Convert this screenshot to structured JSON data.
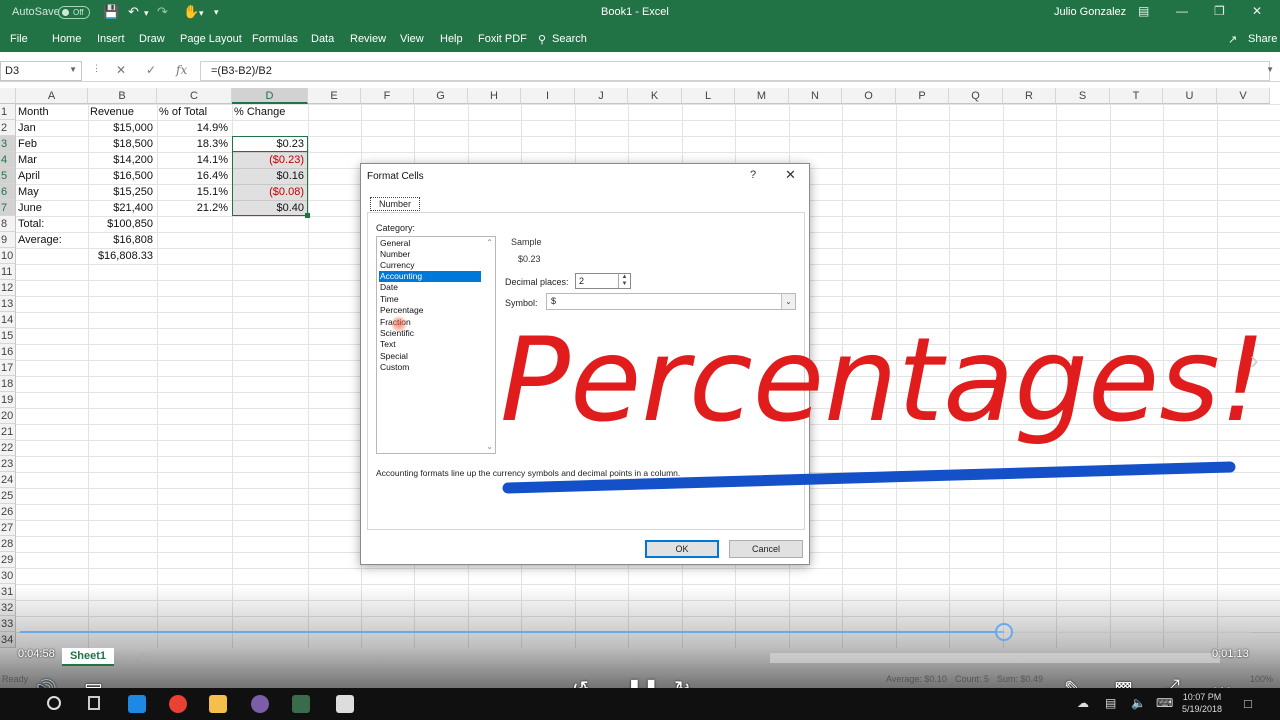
{
  "titlebar": {
    "autosave_label": "AutoSave",
    "autosave_state": "Off",
    "document_title": "Book1  -  Excel",
    "user_name": "Julio Gonzalez"
  },
  "ribbon": {
    "tabs": [
      "File",
      "Home",
      "Insert",
      "Draw",
      "Page Layout",
      "Formulas",
      "Data",
      "Review",
      "View",
      "Help",
      "Foxit PDF"
    ],
    "search_label": "Search",
    "share_label": "Share"
  },
  "formula_bar": {
    "name_box": "D3",
    "formula": "=(B3-B2)/B2"
  },
  "grid": {
    "columns": [
      "A",
      "B",
      "C",
      "D",
      "E",
      "F",
      "G",
      "H",
      "I",
      "J",
      "K",
      "L",
      "M",
      "N",
      "O",
      "P",
      "Q",
      "R",
      "S",
      "T",
      "U",
      "V"
    ],
    "rows": [
      "1",
      "2",
      "3",
      "4",
      "5",
      "6",
      "7",
      "8",
      "9",
      "10",
      "11",
      "12",
      "13",
      "14",
      "15",
      "16",
      "17",
      "18",
      "19",
      "20",
      "21",
      "22",
      "23",
      "24",
      "25",
      "26",
      "27",
      "28",
      "29",
      "30",
      "31",
      "32",
      "33",
      "34"
    ],
    "headers": {
      "a": "Month",
      "b": "Revenue",
      "c": "% of Total",
      "d": "% Change"
    },
    "data_rows": [
      {
        "a": "Jan",
        "b": "$15,000",
        "c": "14.9%",
        "d": ""
      },
      {
        "a": "Feb",
        "b": "$18,500",
        "c": "18.3%",
        "d": "$0.23"
      },
      {
        "a": "Mar",
        "b": "$14,200",
        "c": "14.1%",
        "d": "($0.23)"
      },
      {
        "a": "April",
        "b": "$16,500",
        "c": "16.4%",
        "d": "$0.16"
      },
      {
        "a": "May",
        "b": "$15,250",
        "c": "15.1%",
        "d": "($0.08)"
      },
      {
        "a": "June",
        "b": "$21,400",
        "c": "21.2%",
        "d": "$0.40"
      }
    ],
    "total_label": "Total:",
    "total_value": "$100,850",
    "average_label": "Average:",
    "average_value": "$16,808",
    "row10_value": "$16,808.33"
  },
  "dialog": {
    "title": "Format Cells",
    "help_glyph": "?",
    "close_glyph": "✕",
    "tab_number": "Number",
    "category_label": "Category:",
    "categories": [
      "General",
      "Number",
      "Currency",
      "Accounting",
      "Date",
      "Time",
      "Percentage",
      "Fraction",
      "Scientific",
      "Text",
      "Special",
      "Custom"
    ],
    "selected_category": "Accounting",
    "sample_label": "Sample",
    "sample_value": "$0.23",
    "decimal_places_label": "Decimal places:",
    "decimal_places_value": "2",
    "symbol_label": "Symbol:",
    "symbol_value": "$",
    "description": "Accounting formats line up the currency symbols and decimal points in a column.",
    "ok_label": "OK",
    "cancel_label": "Cancel"
  },
  "annotation": {
    "handwritten_text": "Percentages!",
    "ink_red": "#e01c1c",
    "ink_blue": "#1450c8"
  },
  "player": {
    "elapsed": "0:04:58",
    "remaining": "0:01:13",
    "progress_fraction": 0.8,
    "rewind_label": "10",
    "forward_label": "30"
  },
  "sheets": {
    "active_tab": "Sheet1"
  },
  "statusbar": {
    "ready": "Ready",
    "average": "Average: $0.10",
    "count": "Count: 5",
    "sum": "Sum: $0.49",
    "zoom": "100%"
  },
  "taskbar": {
    "time": "10:07 PM",
    "date": "5/19/2018"
  },
  "colors": {
    "excel_green": "#217346",
    "selection_blue": "#0078d7",
    "negative_red": "#c00000"
  }
}
